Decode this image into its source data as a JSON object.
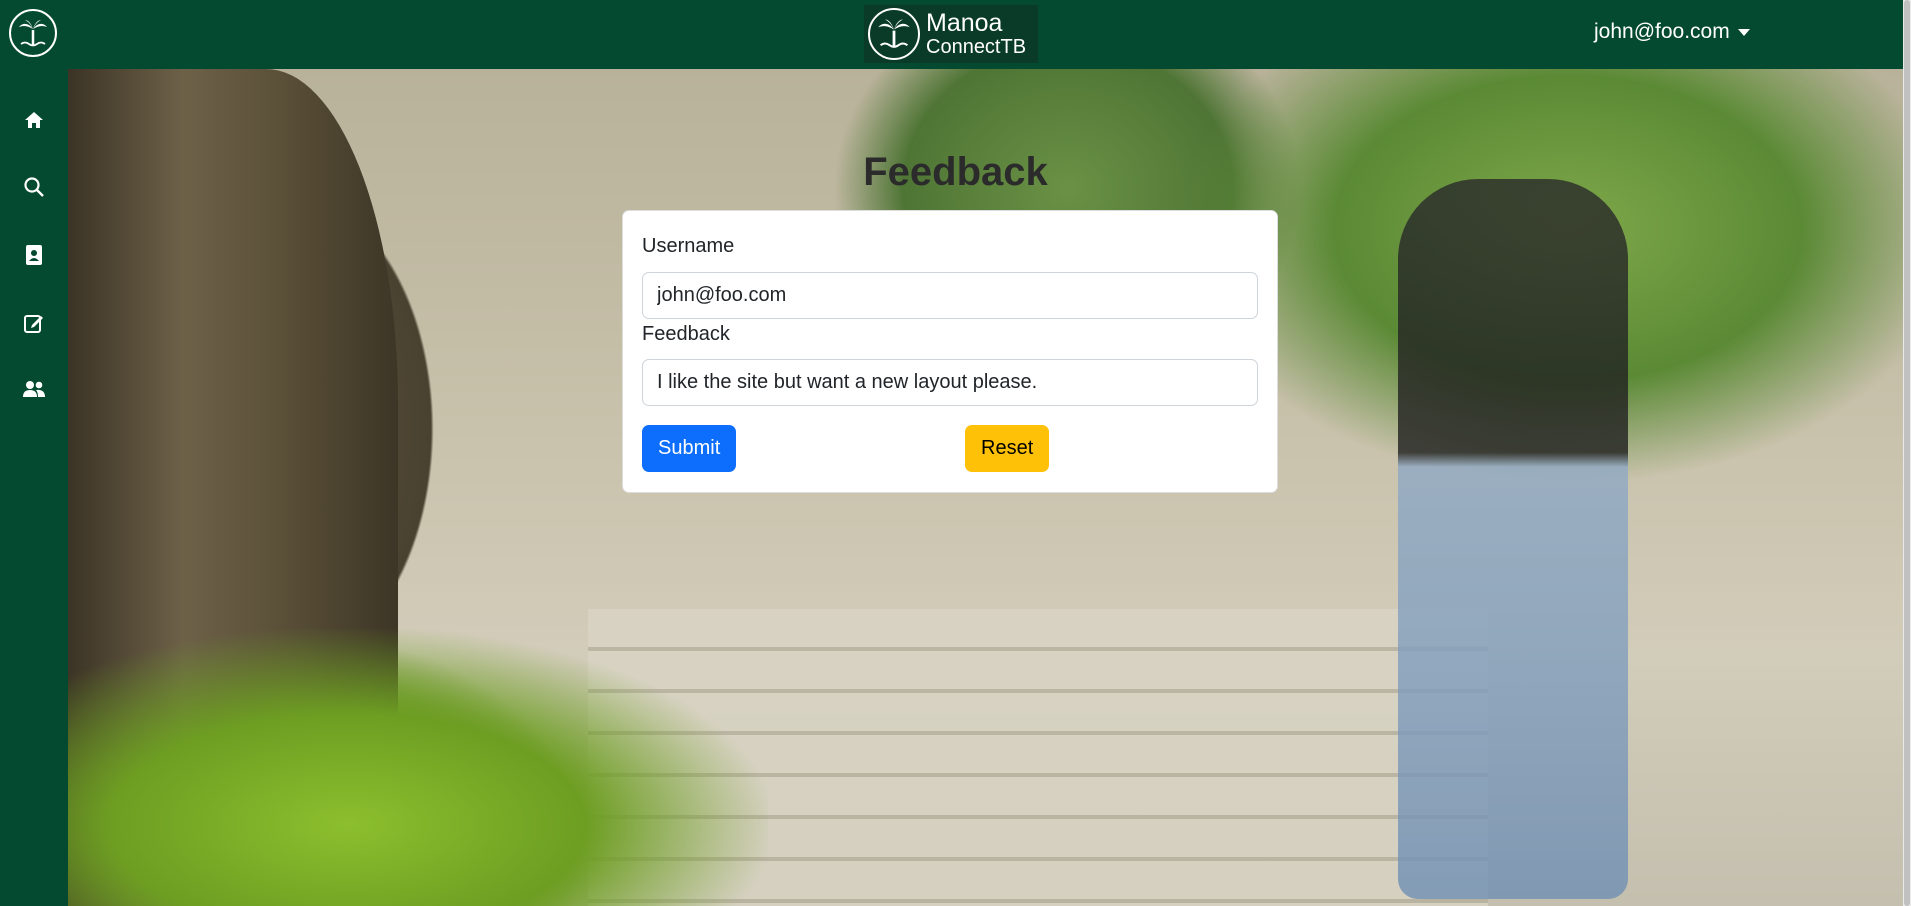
{
  "header": {
    "brand_line1": "Manoa",
    "brand_line2": "ConnectTB",
    "user_email": "john@foo.com"
  },
  "sidebar": {
    "items": [
      {
        "icon": "home-icon"
      },
      {
        "icon": "search-icon"
      },
      {
        "icon": "contact-card-icon"
      },
      {
        "icon": "edit-icon"
      },
      {
        "icon": "users-icon"
      }
    ]
  },
  "page": {
    "title": "Feedback"
  },
  "form": {
    "username_label": "Username",
    "username_value": "john@foo.com",
    "feedback_label": "Feedback",
    "feedback_value": "I like the site but want a new layout please.",
    "submit_label": "Submit",
    "reset_label": "Reset"
  },
  "colors": {
    "nav_green": "#044a30",
    "primary": "#0d6efd",
    "warning": "#ffc107"
  }
}
